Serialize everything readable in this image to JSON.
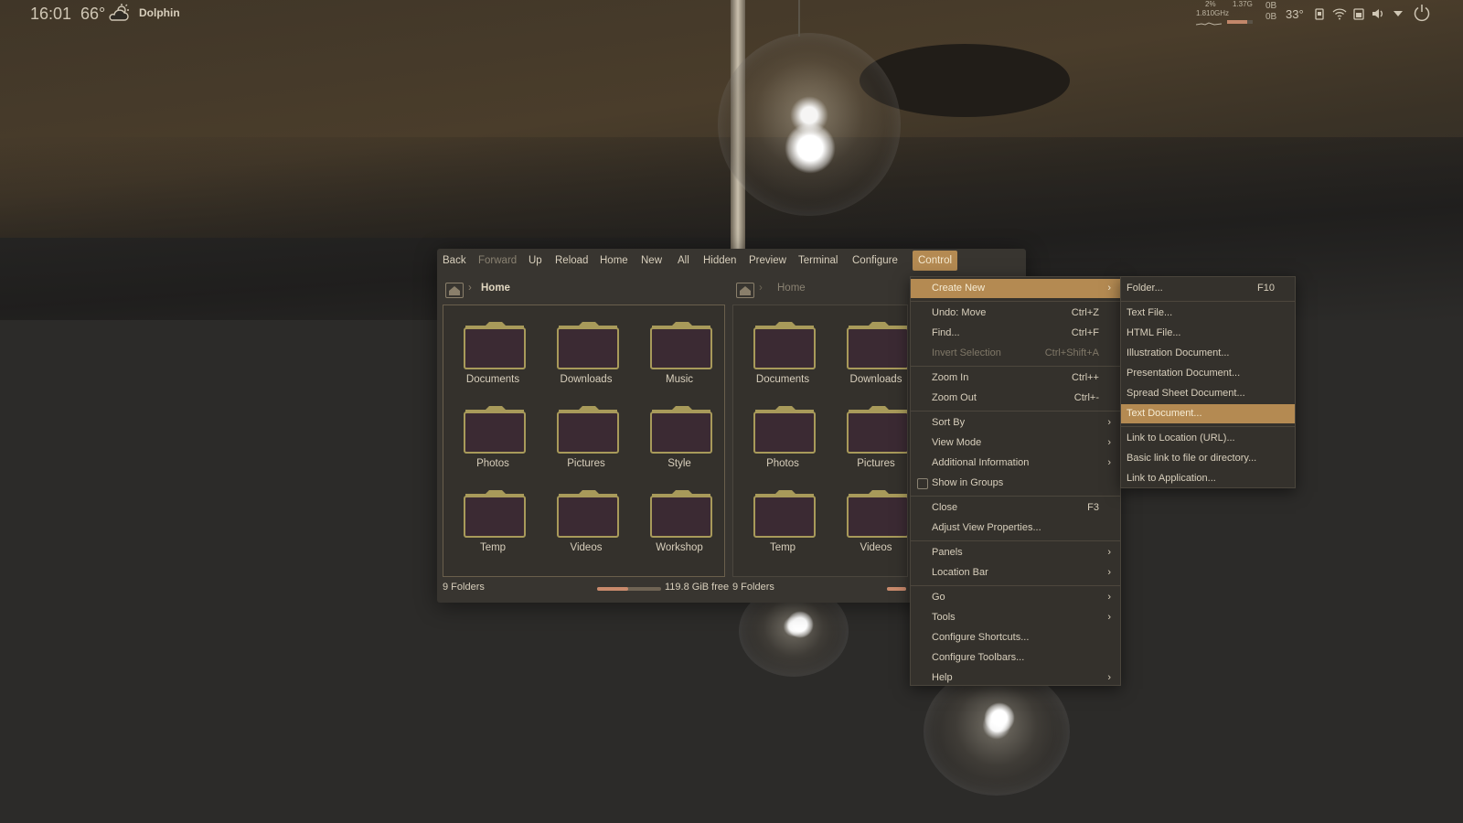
{
  "panel": {
    "clock": "16:01",
    "temperature": "66°",
    "weather_icon": "partly-cloudy-icon",
    "app_name": "Dolphin",
    "cpu_percent": "2%",
    "cpu_freq": "1.810GHz",
    "memory": "1.37G",
    "net_up": "0B",
    "net_down": "0B",
    "cpu_temp": "33°",
    "memory_usage_fraction": 0.8
  },
  "toolbar": {
    "back": "Back",
    "forward": "Forward",
    "up": "Up",
    "reload": "Reload",
    "home": "Home",
    "new": "New",
    "all": "All",
    "hidden": "Hidden",
    "preview": "Preview",
    "terminal": "Terminal",
    "configure": "Configure",
    "control": "Control"
  },
  "left_pane": {
    "breadcrumb": "Home",
    "folders": [
      "Documents",
      "Downloads",
      "Music",
      "Photos",
      "Pictures",
      "Style",
      "Temp",
      "Videos",
      "Workshop"
    ],
    "status": "9 Folders",
    "free_space": "119.8 GiB free",
    "disk_used_fraction": 0.48
  },
  "right_pane": {
    "breadcrumb": "Home",
    "folders": [
      "Documents",
      "Downloads",
      "Photos",
      "Pictures",
      "Temp",
      "Videos"
    ],
    "status": "9 Folders"
  },
  "control_menu": {
    "create_new": "Create New",
    "undo": "Undo: Move",
    "undo_sc": "Ctrl+Z",
    "find": "Find...",
    "find_sc": "Ctrl+F",
    "invert": "Invert Selection",
    "invert_sc": "Ctrl+Shift+A",
    "zoom_in": "Zoom In",
    "zoom_in_sc": "Ctrl++",
    "zoom_out": "Zoom Out",
    "zoom_out_sc": "Ctrl+-",
    "sort_by": "Sort By",
    "view_mode": "View Mode",
    "additional_info": "Additional Information",
    "show_groups": "Show in Groups",
    "close": "Close",
    "close_sc": "F3",
    "adjust_view": "Adjust View Properties...",
    "panels": "Panels",
    "location_bar": "Location Bar",
    "go": "Go",
    "tools": "Tools",
    "configure_shortcuts": "Configure Shortcuts...",
    "configure_toolbars": "Configure Toolbars...",
    "help": "Help"
  },
  "create_new_menu": {
    "folder": "Folder...",
    "folder_sc": "F10",
    "text_file": "Text File...",
    "html_file": "HTML File...",
    "illustration": "Illustration Document...",
    "presentation": "Presentation Document...",
    "spreadsheet": "Spread Sheet Document...",
    "text_document": "Text Document...",
    "link_url": "Link to Location (URL)...",
    "basic_link": "Basic link to file or directory...",
    "link_app": "Link to Application..."
  },
  "colors": {
    "accent": "#b48a52",
    "folder_body": "#3b2a33",
    "folder_tab": "#a89a5a"
  }
}
